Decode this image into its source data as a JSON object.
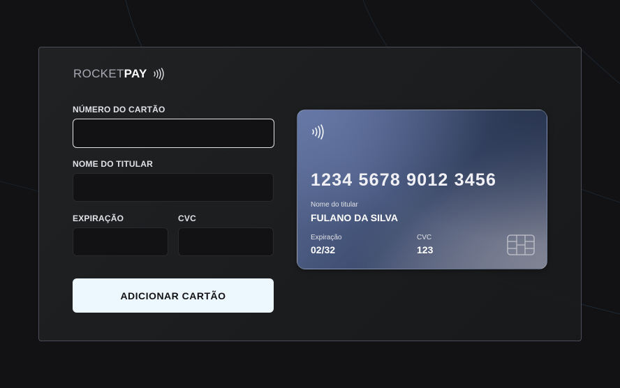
{
  "logo": {
    "prefix": "ROCKET",
    "suffix": "PAY",
    "icon": "contactless-icon"
  },
  "form": {
    "card_number": {
      "label": "NÚMERO DO CARTÃO",
      "value": "",
      "placeholder": ""
    },
    "holder_name": {
      "label": "NOME DO TITULAR",
      "value": "",
      "placeholder": ""
    },
    "expiration": {
      "label": "EXPIRAÇÃO",
      "value": "",
      "placeholder": ""
    },
    "cvc": {
      "label": "CVC",
      "value": "",
      "placeholder": ""
    },
    "submit_label": "ADICIONAR CARTÃO"
  },
  "card_preview": {
    "icon": "contactless-icon",
    "number": "1234 5678 9012 3456",
    "holder_label": "Nome do titular",
    "holder_value": "FULANO DA SILVA",
    "expiration_label": "Expiração",
    "expiration_value": "02/32",
    "cvc_label": "CVC",
    "cvc_value": "123",
    "chip_icon": "chip-icon"
  },
  "colors": {
    "background": "#121214",
    "panel_border": "#4d4d57",
    "input_bg": "#121214",
    "button_bg": "#edf7fe",
    "card_gradient_start": "#5b6b93",
    "card_gradient_end": "#6e7386"
  }
}
